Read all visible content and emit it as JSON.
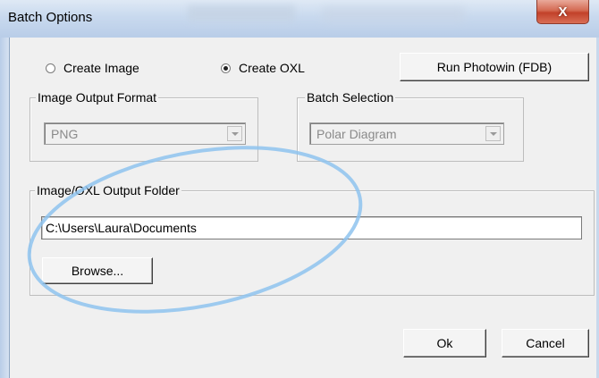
{
  "window": {
    "title": "Batch Options",
    "close_label": "X"
  },
  "mode": {
    "options": [
      {
        "label": "Create Image",
        "checked": false
      },
      {
        "label": "Create OXL",
        "checked": true
      }
    ]
  },
  "run_button_label": "Run Photowin (FDB)",
  "image_output_format": {
    "legend": "Image Output Format",
    "selected": "PNG"
  },
  "batch_selection": {
    "legend": "Batch Selection",
    "selected": "Polar Diagram"
  },
  "output_folder": {
    "legend": "Image/OXL Output Folder",
    "path": "C:\\Users\\Laura\\Documents",
    "browse_label": "Browse..."
  },
  "footer": {
    "ok_label": "Ok",
    "cancel_label": "Cancel"
  },
  "annotation": {
    "shape": "ellipse",
    "color": "#8ec3ee"
  }
}
